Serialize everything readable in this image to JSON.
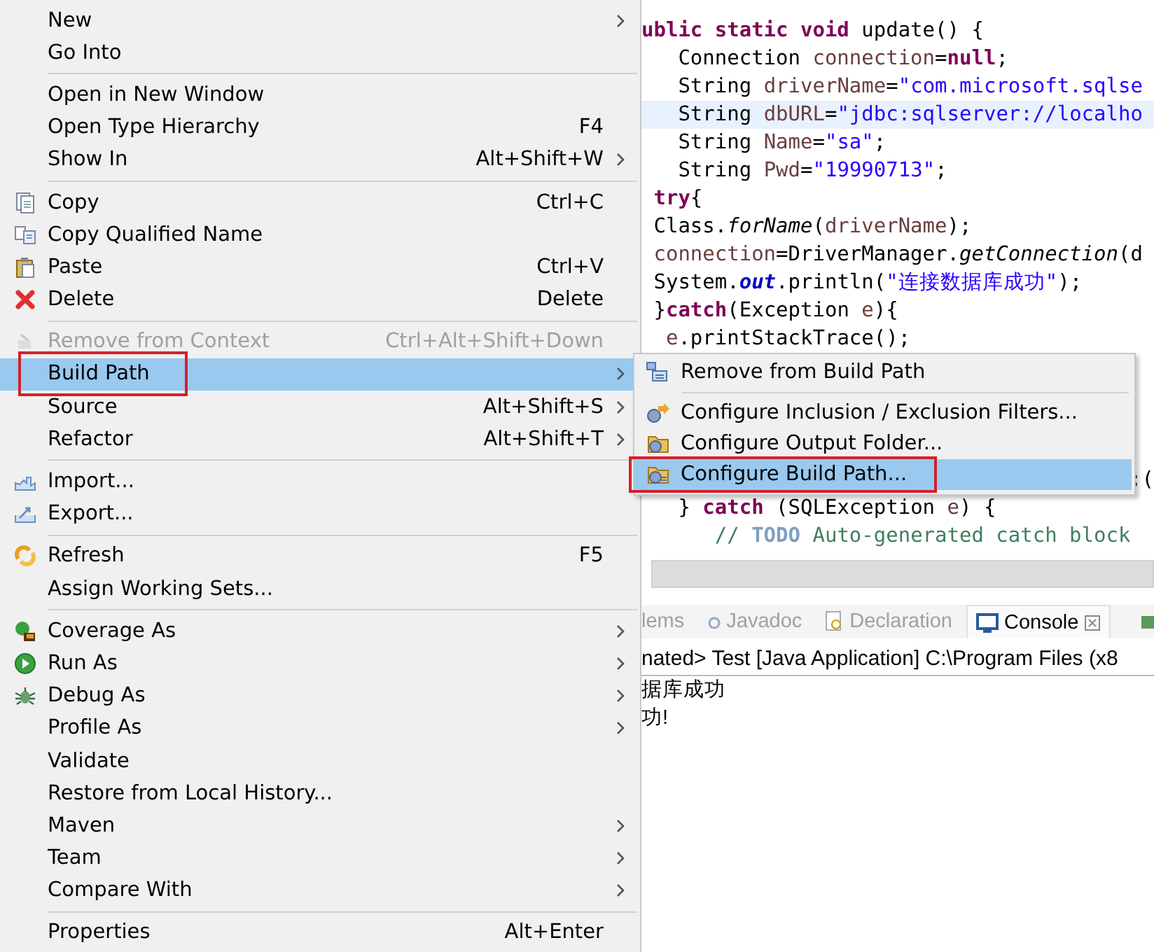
{
  "context_menu": {
    "items": [
      {
        "kind": "item",
        "label": "New",
        "submenu": true,
        "disabled": false,
        "selected": false,
        "annotated": false
      },
      {
        "kind": "item",
        "label": "Go Into",
        "submenu": false,
        "disabled": false,
        "selected": false,
        "annotated": false
      },
      {
        "kind": "separator"
      },
      {
        "kind": "item",
        "label": "Open in New Window",
        "submenu": false,
        "disabled": false,
        "selected": false,
        "annotated": false
      },
      {
        "kind": "item",
        "label": "Open Type Hierarchy",
        "shortcut": "F4",
        "submenu": false,
        "disabled": false,
        "selected": false,
        "annotated": false
      },
      {
        "kind": "item",
        "label": "Show In",
        "shortcut": "Alt+Shift+W",
        "submenu": true,
        "disabled": false,
        "selected": false,
        "annotated": false
      },
      {
        "kind": "separator"
      },
      {
        "kind": "item",
        "label": "Copy",
        "shortcut": "Ctrl+C",
        "submenu": false,
        "disabled": false,
        "selected": false,
        "annotated": false
      },
      {
        "kind": "item",
        "label": "Copy Qualified Name",
        "submenu": false,
        "disabled": false,
        "selected": false,
        "annotated": false
      },
      {
        "kind": "item",
        "label": "Paste",
        "shortcut": "Ctrl+V",
        "submenu": false,
        "disabled": false,
        "selected": false,
        "annotated": false
      },
      {
        "kind": "item",
        "label": "Delete",
        "shortcut": "Delete",
        "submenu": false,
        "disabled": false,
        "selected": false,
        "annotated": false
      },
      {
        "kind": "separator"
      },
      {
        "kind": "item",
        "label": "Remove from Context",
        "shortcut": "Ctrl+Alt+Shift+Down",
        "submenu": false,
        "disabled": true,
        "selected": false,
        "annotated": false
      },
      {
        "kind": "item",
        "label": "Build Path",
        "submenu": true,
        "disabled": false,
        "selected": true,
        "annotated": true
      },
      {
        "kind": "item",
        "label": "Source",
        "shortcut": "Alt+Shift+S",
        "submenu": true,
        "disabled": false,
        "selected": false,
        "annotated": false
      },
      {
        "kind": "item",
        "label": "Refactor",
        "shortcut": "Alt+Shift+T",
        "submenu": true,
        "disabled": false,
        "selected": false,
        "annotated": false
      },
      {
        "kind": "separator"
      },
      {
        "kind": "item",
        "label": "Import...",
        "submenu": false,
        "disabled": false,
        "selected": false,
        "annotated": false
      },
      {
        "kind": "item",
        "label": "Export...",
        "submenu": false,
        "disabled": false,
        "selected": false,
        "annotated": false
      },
      {
        "kind": "separator"
      },
      {
        "kind": "item",
        "label": "Refresh",
        "shortcut": "F5",
        "submenu": false,
        "disabled": false,
        "selected": false,
        "annotated": false
      },
      {
        "kind": "item",
        "label": "Assign Working Sets...",
        "submenu": false,
        "disabled": false,
        "selected": false,
        "annotated": false
      },
      {
        "kind": "separator"
      },
      {
        "kind": "item",
        "label": "Coverage As",
        "submenu": true,
        "disabled": false,
        "selected": false,
        "annotated": false
      },
      {
        "kind": "item",
        "label": "Run As",
        "submenu": true,
        "disabled": false,
        "selected": false,
        "annotated": false
      },
      {
        "kind": "item",
        "label": "Debug As",
        "submenu": true,
        "disabled": false,
        "selected": false,
        "annotated": false
      },
      {
        "kind": "item",
        "label": "Profile As",
        "submenu": true,
        "disabled": false,
        "selected": false,
        "annotated": false
      },
      {
        "kind": "item",
        "label": "Validate",
        "submenu": false,
        "disabled": false,
        "selected": false,
        "annotated": false
      },
      {
        "kind": "item",
        "label": "Restore from Local History...",
        "submenu": false,
        "disabled": false,
        "selected": false,
        "annotated": false
      },
      {
        "kind": "item",
        "label": "Maven",
        "submenu": true,
        "disabled": false,
        "selected": false,
        "annotated": false
      },
      {
        "kind": "item",
        "label": "Team",
        "submenu": true,
        "disabled": false,
        "selected": false,
        "annotated": false
      },
      {
        "kind": "item",
        "label": "Compare With",
        "submenu": true,
        "disabled": false,
        "selected": false,
        "annotated": false
      },
      {
        "kind": "separator"
      },
      {
        "kind": "item",
        "label": "Properties",
        "shortcut": "Alt+Enter",
        "submenu": false,
        "disabled": false,
        "selected": false,
        "annotated": false
      }
    ]
  },
  "submenu": {
    "items": [
      {
        "kind": "item",
        "label": "Remove from Build Path",
        "selected": false,
        "annotated": false
      },
      {
        "kind": "separator"
      },
      {
        "kind": "item",
        "label": "Configure Inclusion / Exclusion Filters...",
        "selected": false,
        "annotated": false
      },
      {
        "kind": "item",
        "label": "Configure Output Folder...",
        "selected": false,
        "annotated": false
      },
      {
        "kind": "item",
        "label": "Configure Build Path...",
        "selected": true,
        "annotated": true
      }
    ]
  },
  "editor": {
    "lines": [
      {
        "current": false,
        "tokens": [
          {
            "kind": "keyword",
            "text": "ublic static void"
          },
          {
            "kind": "plain",
            "text": " update() {"
          }
        ]
      },
      {
        "current": false,
        "tokens": [
          {
            "kind": "plain",
            "text": "   Connection "
          },
          {
            "kind": "variable",
            "text": "connection"
          },
          {
            "kind": "plain",
            "text": "="
          },
          {
            "kind": "keyword",
            "text": "null"
          },
          {
            "kind": "plain",
            "text": ";"
          }
        ]
      },
      {
        "current": false,
        "tokens": [
          {
            "kind": "plain",
            "text": "   String "
          },
          {
            "kind": "variable",
            "text": "driverName"
          },
          {
            "kind": "plain",
            "text": "="
          },
          {
            "kind": "string",
            "text": "\"com.microsoft.sqlse"
          }
        ]
      },
      {
        "current": true,
        "tokens": [
          {
            "kind": "plain",
            "text": "   String "
          },
          {
            "kind": "variable",
            "text": "dbURL"
          },
          {
            "kind": "plain",
            "text": "="
          },
          {
            "kind": "string",
            "text": "\"jdbc:sqlserver://localho"
          }
        ]
      },
      {
        "current": false,
        "tokens": [
          {
            "kind": "plain",
            "text": "   String "
          },
          {
            "kind": "variable",
            "text": "Name"
          },
          {
            "kind": "plain",
            "text": "="
          },
          {
            "kind": "string",
            "text": "\"sa\""
          },
          {
            "kind": "plain",
            "text": ";"
          }
        ]
      },
      {
        "current": false,
        "tokens": [
          {
            "kind": "plain",
            "text": "   String "
          },
          {
            "kind": "variable",
            "text": "Pwd"
          },
          {
            "kind": "plain",
            "text": "="
          },
          {
            "kind": "string",
            "text": "\"19990713\""
          },
          {
            "kind": "plain",
            "text": ";"
          }
        ]
      },
      {
        "current": false,
        "tokens": [
          {
            "kind": "keyword",
            "text": " try"
          },
          {
            "kind": "plain",
            "text": "{"
          }
        ]
      },
      {
        "current": false,
        "tokens": [
          {
            "kind": "plain",
            "text": " Class."
          },
          {
            "kind": "method",
            "text": "forName"
          },
          {
            "kind": "plain",
            "text": "("
          },
          {
            "kind": "variable",
            "text": "driverName"
          },
          {
            "kind": "plain",
            "text": ");"
          }
        ]
      },
      {
        "current": false,
        "tokens": [
          {
            "kind": "variable",
            "text": " connection"
          },
          {
            "kind": "plain",
            "text": "=DriverManager."
          },
          {
            "kind": "method",
            "text": "getConnection"
          },
          {
            "kind": "plain",
            "text": "(d"
          }
        ]
      },
      {
        "current": false,
        "tokens": [
          {
            "kind": "plain",
            "text": " System."
          },
          {
            "kind": "field",
            "text": "out"
          },
          {
            "kind": "plain",
            "text": ".println("
          },
          {
            "kind": "string",
            "text": "\"连接数据库成功\""
          },
          {
            "kind": "plain",
            "text": ");"
          }
        ]
      },
      {
        "current": false,
        "tokens": [
          {
            "kind": "plain",
            "text": " }"
          },
          {
            "kind": "keyword",
            "text": "catch"
          },
          {
            "kind": "plain",
            "text": "(Exception "
          },
          {
            "kind": "variable",
            "text": "e"
          },
          {
            "kind": "plain",
            "text": "){"
          }
        ]
      },
      {
        "current": false,
        "tokens": [
          {
            "kind": "variable",
            "text": "  e"
          },
          {
            "kind": "plain",
            "text": ".printStackTrace();"
          }
        ]
      }
    ],
    "lines_below": [
      {
        "kind": "tail",
        "current": false,
        "tokens": [
          {
            "kind": "plain",
            "text": ":("
          }
        ]
      },
      {
        "kind": "code",
        "current": false,
        "tokens": [
          {
            "kind": "plain",
            "text": "   } "
          },
          {
            "kind": "keyword",
            "text": "catch"
          },
          {
            "kind": "plain",
            "text": " (SQLException "
          },
          {
            "kind": "variable",
            "text": "e"
          },
          {
            "kind": "plain",
            "text": ") {"
          }
        ]
      },
      {
        "kind": "code",
        "current": false,
        "tokens": [
          {
            "kind": "comment",
            "text": "      // "
          },
          {
            "kind": "todo",
            "text": "TODO"
          },
          {
            "kind": "comment",
            "text": " Auto-generated catch block"
          }
        ]
      }
    ]
  },
  "bottom_panel": {
    "tabs": [
      {
        "label": "lems",
        "selected": false,
        "closable": false
      },
      {
        "label": "Javadoc",
        "selected": false,
        "closable": false
      },
      {
        "label": "Declaration",
        "selected": false,
        "closable": false
      },
      {
        "label": "Console",
        "selected": true,
        "closable": true
      }
    ],
    "console_header": "nated> Test [Java Application] C:\\Program Files (x8",
    "output": [
      "据库成功",
      "功!"
    ]
  }
}
